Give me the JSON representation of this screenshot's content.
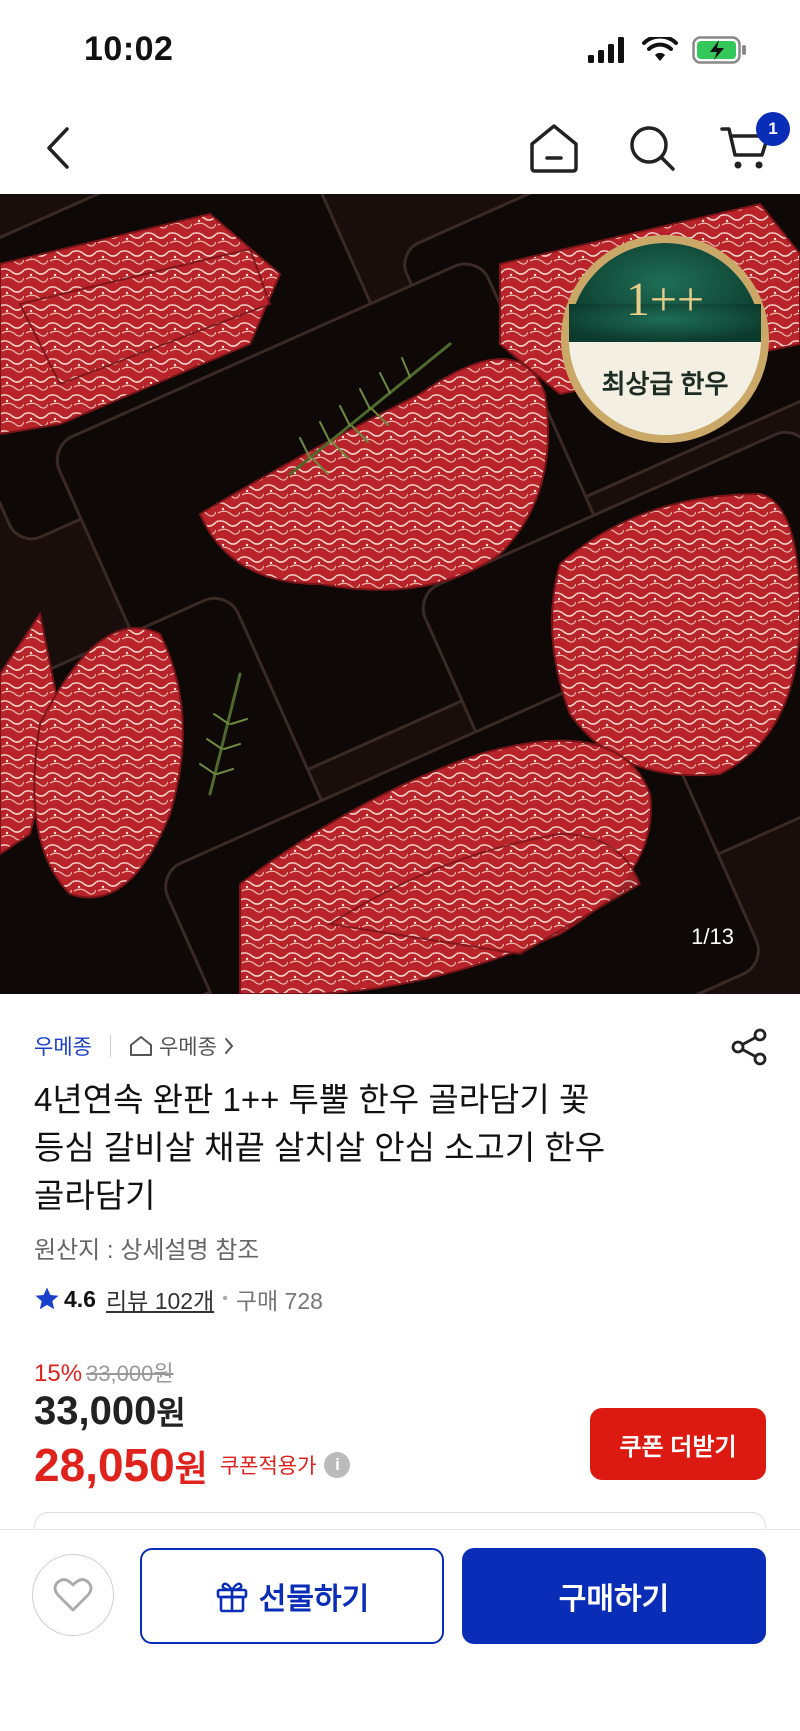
{
  "status_bar": {
    "time": "10:02"
  },
  "top_nav": {
    "cart_count": "1"
  },
  "gallery": {
    "counter": "1/13",
    "badge_main": "1++",
    "badge_sub": "최상급 한우"
  },
  "seller": {
    "brand": "우메종",
    "store": "우메종"
  },
  "product": {
    "title_line1": "4년연속 완판 1++ 투뿔 한우 골라담기 꽃",
    "title_line2": "등심 갈비살 채끝 살치살 안심 소고기 한우",
    "title_line3": "골라담기",
    "origin": "원산지 : 상세설명 참조",
    "rating": "4.6",
    "review_link": "리뷰 102개",
    "purchase": "구매 728"
  },
  "pricing": {
    "discount_rate": "15%",
    "original_price": "33,000원",
    "price_number": "33,000",
    "price_unit": "원",
    "coupon_price_number": "28,050",
    "coupon_price_unit": "원",
    "coupon_label": "쿠폰적용가",
    "info_glyph": "i",
    "coupon_button": "쿠폰 더받기"
  },
  "bottom_bar": {
    "gift_label": "선물하기",
    "buy_label": "구매하기"
  },
  "colors": {
    "brand_blue": "#0a2db8",
    "sale_red": "#e0221c",
    "coupon_button_red": "#dd1a12"
  }
}
